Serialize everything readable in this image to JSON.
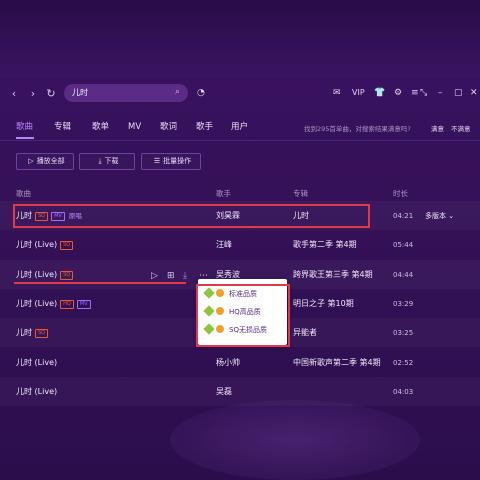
{
  "toolbar": {
    "back_icon": "chevron-left-icon",
    "forward_icon": "chevron-right-icon",
    "refresh_icon": "refresh-icon",
    "search_value": "儿时",
    "vip_label": "VIP",
    "icons": [
      "mail-icon",
      "shirt-icon",
      "gear-icon",
      "menu-icon",
      "mini-mode-icon",
      "minimize-icon",
      "maximize-icon",
      "close-icon"
    ]
  },
  "tabs": [
    {
      "label": "歌曲"
    },
    {
      "label": "专辑"
    },
    {
      "label": "歌单"
    },
    {
      "label": "MV"
    },
    {
      "label": "歌词"
    },
    {
      "label": "歌手"
    },
    {
      "label": "用户"
    }
  ],
  "found": {
    "text": "找到295首单曲，对搜索结果满意吗?",
    "satisfied": "满意",
    "unsatisfied": "不满意"
  },
  "actions": {
    "play_all": "播放全部",
    "download": "下载",
    "batch": "批量操作"
  },
  "columns": {
    "song": "歌曲",
    "singer": "歌手",
    "album": "专辑",
    "duration": "时长"
  },
  "rows": [
    {
      "title": "儿时",
      "badges": [
        "SQ",
        "MV"
      ],
      "extra": "原唱",
      "singer": "刘昊霖",
      "album": "儿时",
      "duration": "04:21",
      "versions": "多版本"
    },
    {
      "title": "儿时 (Live)",
      "badges": [
        "SQ"
      ],
      "singer": "汪峰",
      "album": "歌手第二季 第4期",
      "duration": "05:44"
    },
    {
      "title": "儿时 (Live)",
      "badges": [
        "SQ"
      ],
      "singer": "吴秀波",
      "album": "跨界歌王第三季 第4期",
      "duration": "04:44"
    },
    {
      "title": "儿时 (Live)",
      "badges": [
        "HQ",
        "MV"
      ],
      "singer": "",
      "album": "明日之子 第10期",
      "duration": "03:29"
    },
    {
      "title": "儿时",
      "badges": [
        "SQ"
      ],
      "singer": "",
      "album": "异能者",
      "duration": "03:25"
    },
    {
      "title": "儿时 (Live)",
      "badges": [],
      "singer": "杨小帅",
      "album": "中国新歌声第二季 第4期",
      "duration": "02:52"
    },
    {
      "title": "儿时 (Live)",
      "badges": [],
      "singer": "吴磊",
      "album": "",
      "duration": "04:03"
    }
  ],
  "download_menu": [
    {
      "label": "标准品质"
    },
    {
      "label": "HQ高品质"
    },
    {
      "label": "SQ无损品质"
    }
  ]
}
